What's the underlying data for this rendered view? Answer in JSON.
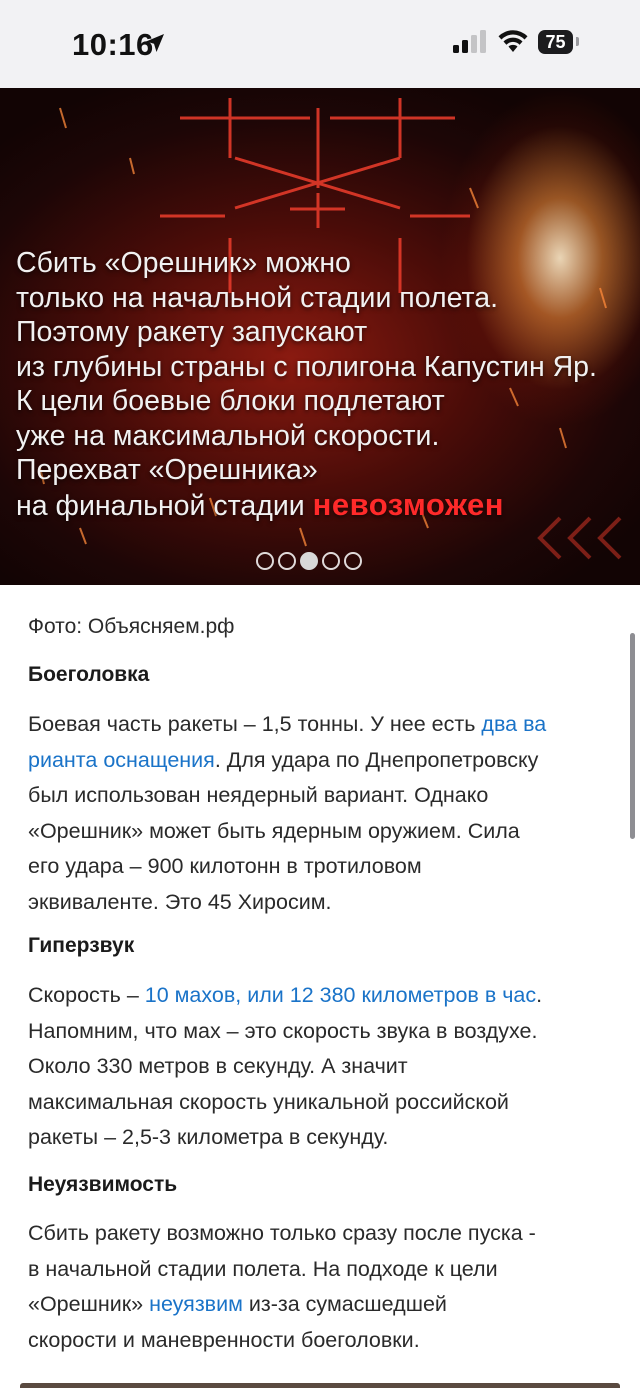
{
  "status_bar": {
    "time": "10:16",
    "battery": "75"
  },
  "hero": {
    "text_lines": [
      "Сбить «Орешник» можно",
      "только на начальной стадии полета.",
      "Поэтому ракету запускают",
      "из глубины страны с полигона Капустин Яр.",
      "К цели боевые блоки подлетают",
      "уже на максимальной скорости.",
      "Перехват «Орешника»",
      "на финальной стадии"
    ],
    "accent_word": "невозможен",
    "slides_total": 5,
    "active_slide": 3
  },
  "article": {
    "caption": "Фото: Объясняем.рф",
    "sections": [
      {
        "heading": "Боеголовка",
        "lines": [
          {
            "before": "Боевая часть ракеты – 1,5 тонны. У нее есть ",
            "link": "два ва",
            "after": ""
          },
          {
            "before": "",
            "link": "рианта оснащения",
            "after": ". Для удара по Днепропетровску"
          },
          {
            "before": "был использован неядерный вариант. Однако",
            "link": "",
            "after": ""
          },
          {
            "before": "«Орешник» может быть ядерным оружием. Сила",
            "link": "",
            "after": ""
          },
          {
            "before": "его удара – 900 килотонн в тротиловом",
            "link": "",
            "after": ""
          },
          {
            "before": "эквиваленте. Это 45 Хиросим.",
            "link": "",
            "after": ""
          }
        ]
      },
      {
        "heading": "Гиперзвук",
        "lines": [
          {
            "before": "Скорость – ",
            "link": "10 махов, или 12 380 километров в час",
            "after": "."
          },
          {
            "before": "Напомним, что мах – это скорость звука в воздухе.",
            "link": "",
            "after": ""
          },
          {
            "before": "Около 330 метров в секунду. А значит",
            "link": "",
            "after": ""
          },
          {
            "before": "максимальная скорость уникальной российской",
            "link": "",
            "after": ""
          },
          {
            "before": "ракеты – 2,5-3 километра в секунду.",
            "link": "",
            "after": ""
          }
        ]
      },
      {
        "heading": "Неуязвимость",
        "lines": [
          {
            "before": "Сбить ракету возможно только сразу после пуска -",
            "link": "",
            "after": ""
          },
          {
            "before": "в начальной стадии полета. На подходе к цели",
            "link": "",
            "after": ""
          },
          {
            "before": "«Орешник» ",
            "link": "неуязвим",
            "after": " из-за сумасшедшей"
          },
          {
            "before": "скорости и маневренности боеголовки.",
            "link": "",
            "after": ""
          }
        ]
      }
    ]
  },
  "colors": {
    "link": "#1a73c8",
    "accent": "#ff2a2a",
    "background": "#ffffff"
  }
}
